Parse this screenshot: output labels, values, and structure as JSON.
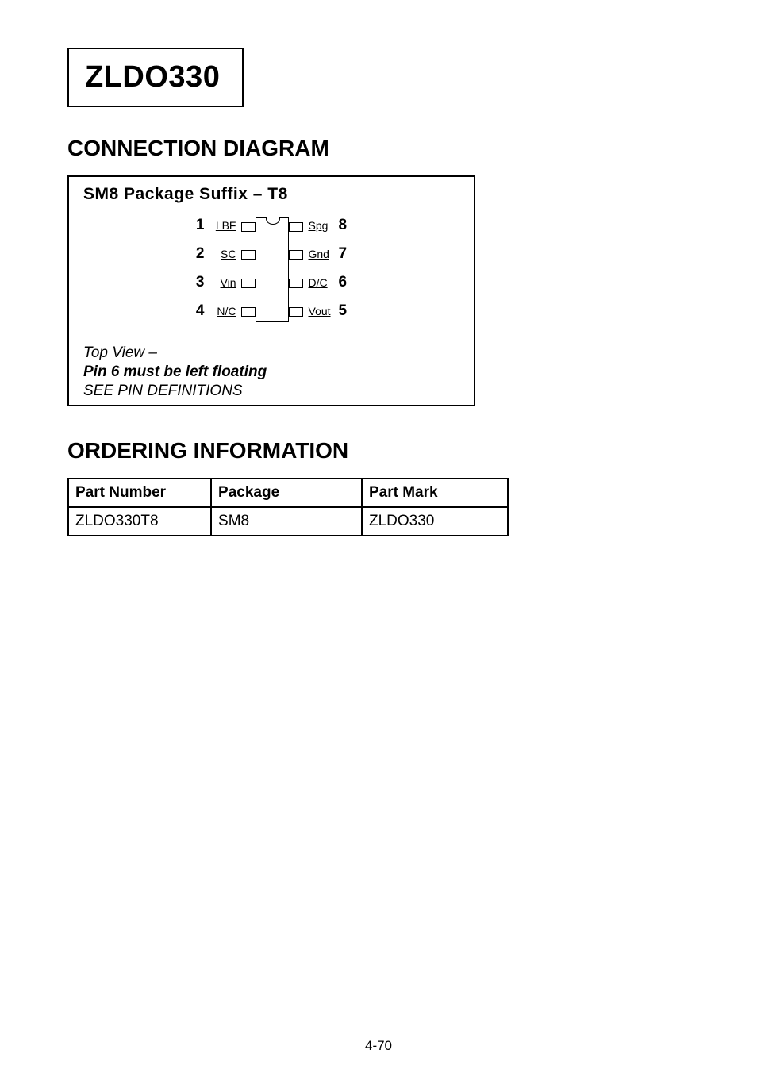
{
  "title": "ZLDO330",
  "sections": {
    "connection": {
      "heading": "CONNECTION DIAGRAM",
      "box_title": "SM8   Package Suffix  –  T8",
      "left_pins": [
        {
          "num": "1",
          "label": "LBF"
        },
        {
          "num": "2",
          "label": "SC"
        },
        {
          "num": "3",
          "label": "Vin"
        },
        {
          "num": "4",
          "label": "N/C"
        }
      ],
      "right_pins": [
        {
          "num": "8",
          "label": "Spg"
        },
        {
          "num": "7",
          "label": "Gnd"
        },
        {
          "num": "6",
          "label": "D/C"
        },
        {
          "num": "5",
          "label": "Vout"
        }
      ],
      "note_line1": "Top View  –",
      "note_line2": "Pin 6 must be left floating",
      "note_line3": "SEE PIN DEFINITIONS"
    },
    "ordering": {
      "heading": "ORDERING INFORMATION",
      "headers": {
        "part_number": "Part Number",
        "package": "Package",
        "part_mark": "Part Mark"
      },
      "rows": [
        {
          "part_number": "ZLDO330T8",
          "package": "SM8",
          "part_mark": "ZLDO330"
        }
      ]
    }
  },
  "page_number": "4-70"
}
